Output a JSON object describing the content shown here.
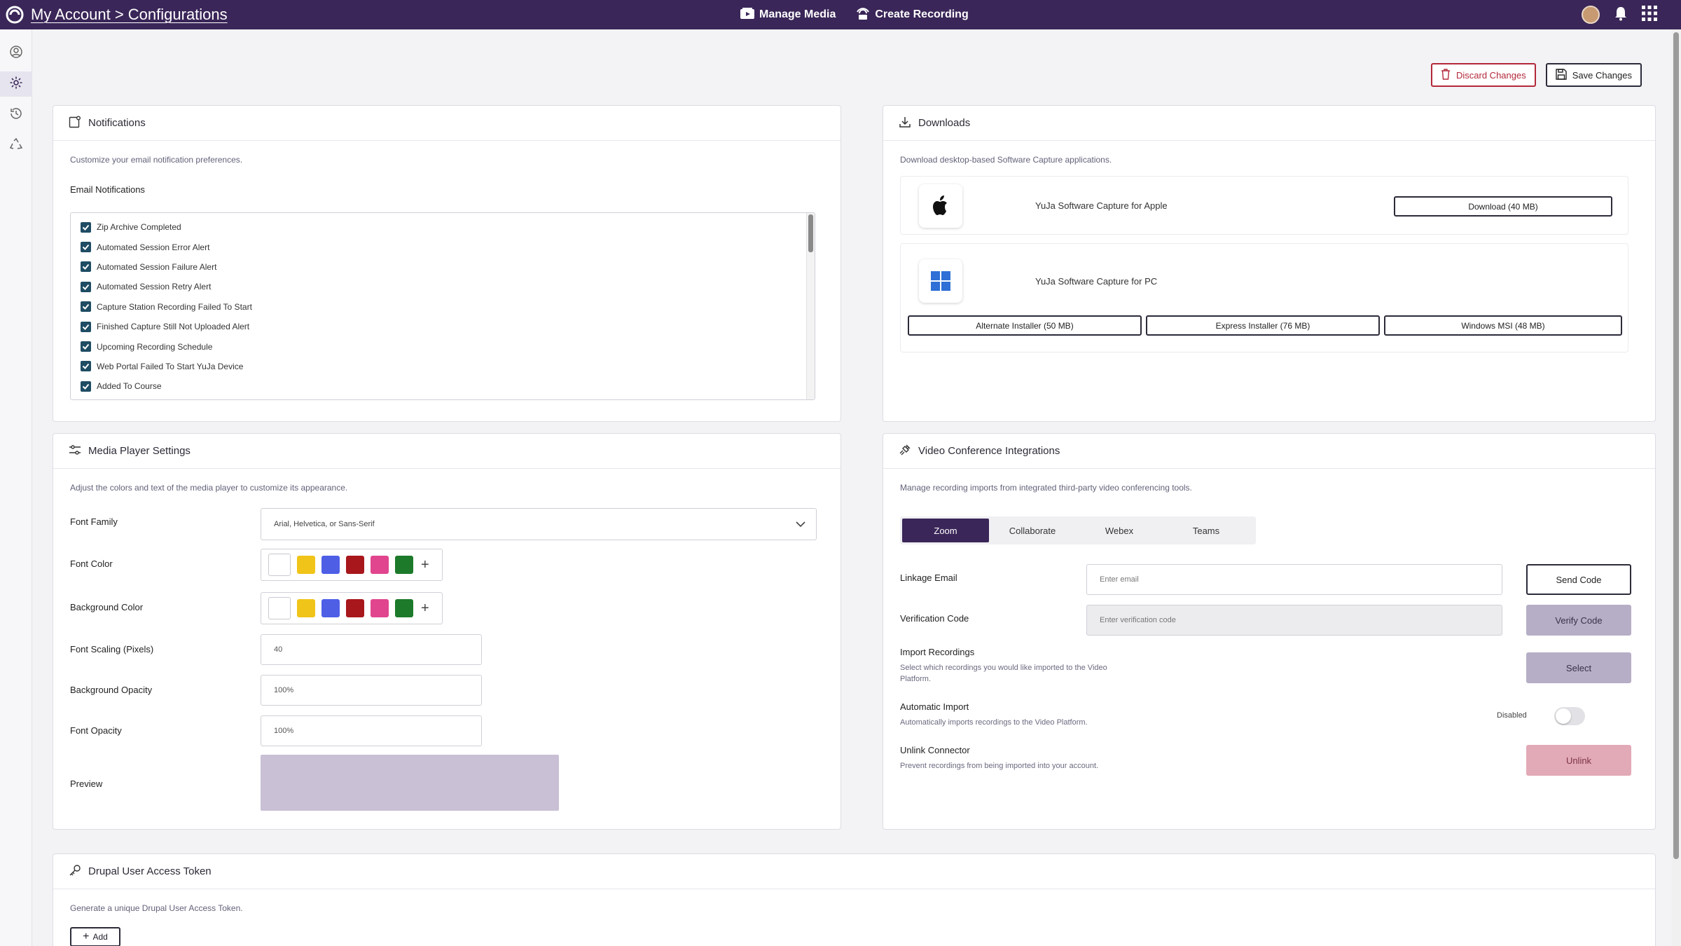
{
  "app": {
    "breadcrumb": "My Account > Configurations"
  },
  "topnav": {
    "manage_media": "Manage Media",
    "create_recording": "Create Recording"
  },
  "actions": {
    "discard": "Discard Changes",
    "save": "Save Changes"
  },
  "notifications": {
    "title": "Notifications",
    "description": "Customize your email notification preferences.",
    "list_label": "Email Notifications",
    "items": [
      "Zip Archive Completed",
      "Automated Session Error Alert",
      "Automated Session Failure Alert",
      "Automated Session Retry Alert",
      "Capture Station Recording Failed To Start",
      "Finished Capture Still Not Uploaded Alert",
      "Upcoming Recording Schedule",
      "Web Portal Failed To Start YuJa Device",
      "Added To Course"
    ]
  },
  "downloads": {
    "title": "Downloads",
    "description": "Download desktop-based Software Capture applications.",
    "apple": {
      "name": "YuJa Software Capture for Apple",
      "button": "Download (40 MB)"
    },
    "pc": {
      "name": "YuJa Software Capture for PC",
      "alt": "Alternate Installer (50 MB)",
      "express": "Express Installer (76 MB)",
      "msi": "Windows MSI (48 MB)"
    }
  },
  "media_player": {
    "title": "Media Player Settings",
    "description": "Adjust the colors and text of the media player to customize its appearance.",
    "font_family_label": "Font Family",
    "font_family_value": "Arial, Helvetica, or Sans-Serif",
    "font_color_label": "Font Color",
    "background_color_label": "Background Color",
    "font_scaling_label": "Font Scaling (Pixels)",
    "font_scaling_value": "40",
    "background_opacity_label": "Background Opacity",
    "background_opacity_value": "100%",
    "font_opacity_label": "Font Opacity",
    "font_opacity_value": "100%",
    "preview_label": "Preview",
    "swatch_colors": [
      "#ffffff",
      "#f0c419",
      "#4e5fe6",
      "#a8171c",
      "#e0458e",
      "#1c7a2a"
    ],
    "preview_color": "#c9c0d5"
  },
  "video_conf": {
    "title": "Video Conference Integrations",
    "description": "Manage recording imports from integrated third-party video conferencing tools.",
    "tabs": [
      "Zoom",
      "Collaborate",
      "Webex",
      "Teams"
    ],
    "linkage_email_label": "Linkage Email",
    "linkage_email_placeholder": "Enter email",
    "send_code": "Send Code",
    "verification_label": "Verification Code",
    "verification_placeholder": "Enter verification code",
    "verify_code": "Verify Code",
    "import_label": "Import Recordings",
    "import_sub": "Select which recordings you would like imported to the Video Platform.",
    "select": "Select",
    "auto_import_label": "Automatic Import",
    "auto_import_sub": "Automatically imports recordings to the Video Platform.",
    "auto_import_state": "Disabled",
    "unlink_label": "Unlink Connector",
    "unlink_sub": "Prevent recordings from being imported into your account.",
    "unlink": "Unlink"
  },
  "drupal": {
    "title": "Drupal User Access Token",
    "description": "Generate a unique Drupal User Access Token.",
    "add": "Add"
  },
  "colors": {
    "brand": "#3a2658",
    "danger": "#b3283a"
  }
}
